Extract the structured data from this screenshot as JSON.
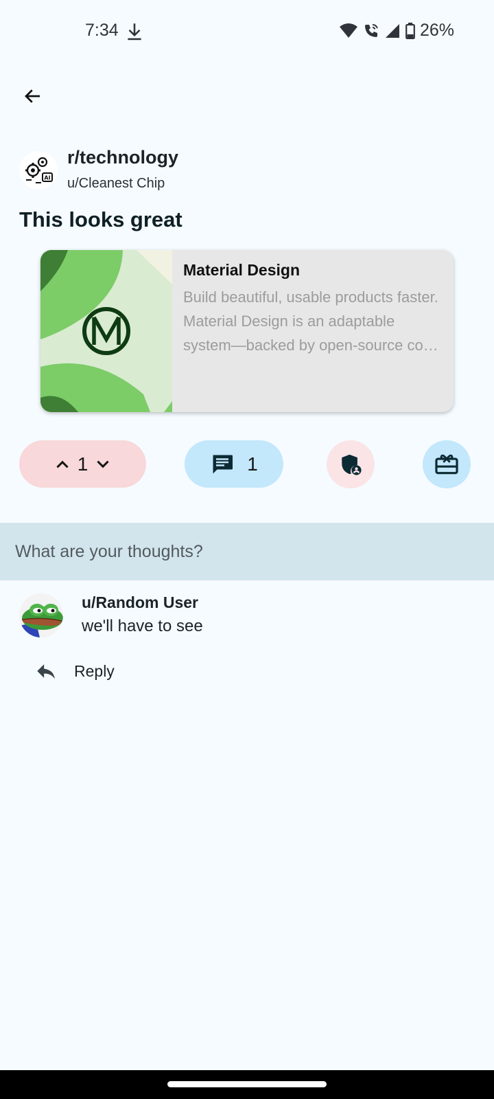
{
  "status_bar": {
    "time": "7:34",
    "battery": "26%",
    "icons": [
      "download-icon",
      "wifi-icon",
      "wifi-call-icon",
      "signal-icon",
      "battery-icon"
    ]
  },
  "nav": {
    "back_icon": "arrow-back-icon"
  },
  "post": {
    "subreddit": "r/technology",
    "author": "u/Cleanest Chip",
    "title": "This looks great",
    "link_preview": {
      "title": "Material Design",
      "description": "Build beautiful, usable products faster. Material Design is an adaptable system—backed by open-source code—that helps teams build high-quality digital experiences."
    },
    "votes": "1",
    "comment_count": "1"
  },
  "comment_input": {
    "placeholder": "What are your thoughts?"
  },
  "comments": [
    {
      "user": "u/Random User",
      "text": "we'll have to see",
      "reply_label": "Reply"
    }
  ],
  "colors": {
    "background": "#f6fbff",
    "vote_pill": "#f8d8da",
    "comment_pill": "#c3e7fb",
    "mod_button": "#fae4e6",
    "input_bar": "#d3e5ec",
    "title_text": "#0f2025"
  }
}
